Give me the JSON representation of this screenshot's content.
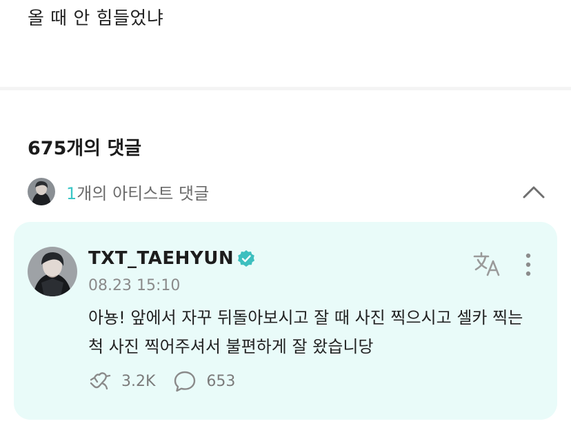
{
  "post": {
    "text": "올 때 안 힘들었냐"
  },
  "comments": {
    "count_label": "675개의 댓글",
    "artist_comments": {
      "count": "1",
      "label": "개의 아티스트 댓글"
    }
  },
  "artist_comment": {
    "author": "TXT_TAEHYUN",
    "timestamp": "08.23 15:10",
    "text": "아뇽! 앞에서 자꾸 뒤돌아보시고 잘 때 사진 찍으시고 셀카 찍는 척 사진 찍어주셔서 불편하게 잘 왔습니당",
    "likes": "3.2K",
    "replies": "653"
  },
  "icons": {
    "verified": "verified-badge-icon",
    "translate": "translate-icon",
    "more": "more-vertical-icon",
    "like": "heart-hand-icon",
    "reply": "speech-bubble-icon",
    "chevron": "chevron-up-icon"
  },
  "colors": {
    "accent": "#39c6c6",
    "card_bg": "#e9fbf9",
    "verified": "#3dbfbf"
  }
}
